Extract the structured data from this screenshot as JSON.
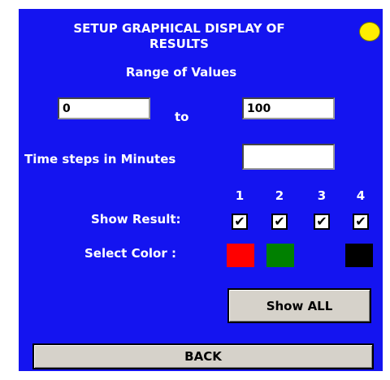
{
  "title_line1": "SETUP GRAPHICAL DISPLAY OF",
  "title_line2": "RESULTS",
  "subtitle": "Range of Values",
  "range": {
    "min": "0",
    "to_label": "to",
    "max": "100"
  },
  "time_steps": {
    "label": "Time steps in Minutes",
    "value": ""
  },
  "results": {
    "show_label": "Show Result:",
    "color_label": "Select Color :",
    "columns": [
      {
        "number": "1",
        "checked": true,
        "color": "#ff0000"
      },
      {
        "number": "2",
        "checked": true,
        "color": "#008000"
      },
      {
        "number": "3",
        "checked": true,
        "color": ""
      },
      {
        "number": "4",
        "checked": true,
        "color": "#000000"
      }
    ]
  },
  "buttons": {
    "show_all": "Show ALL",
    "back": "BACK"
  },
  "colors": {
    "panel": "#1414f0",
    "indicator": "#ffee00"
  }
}
